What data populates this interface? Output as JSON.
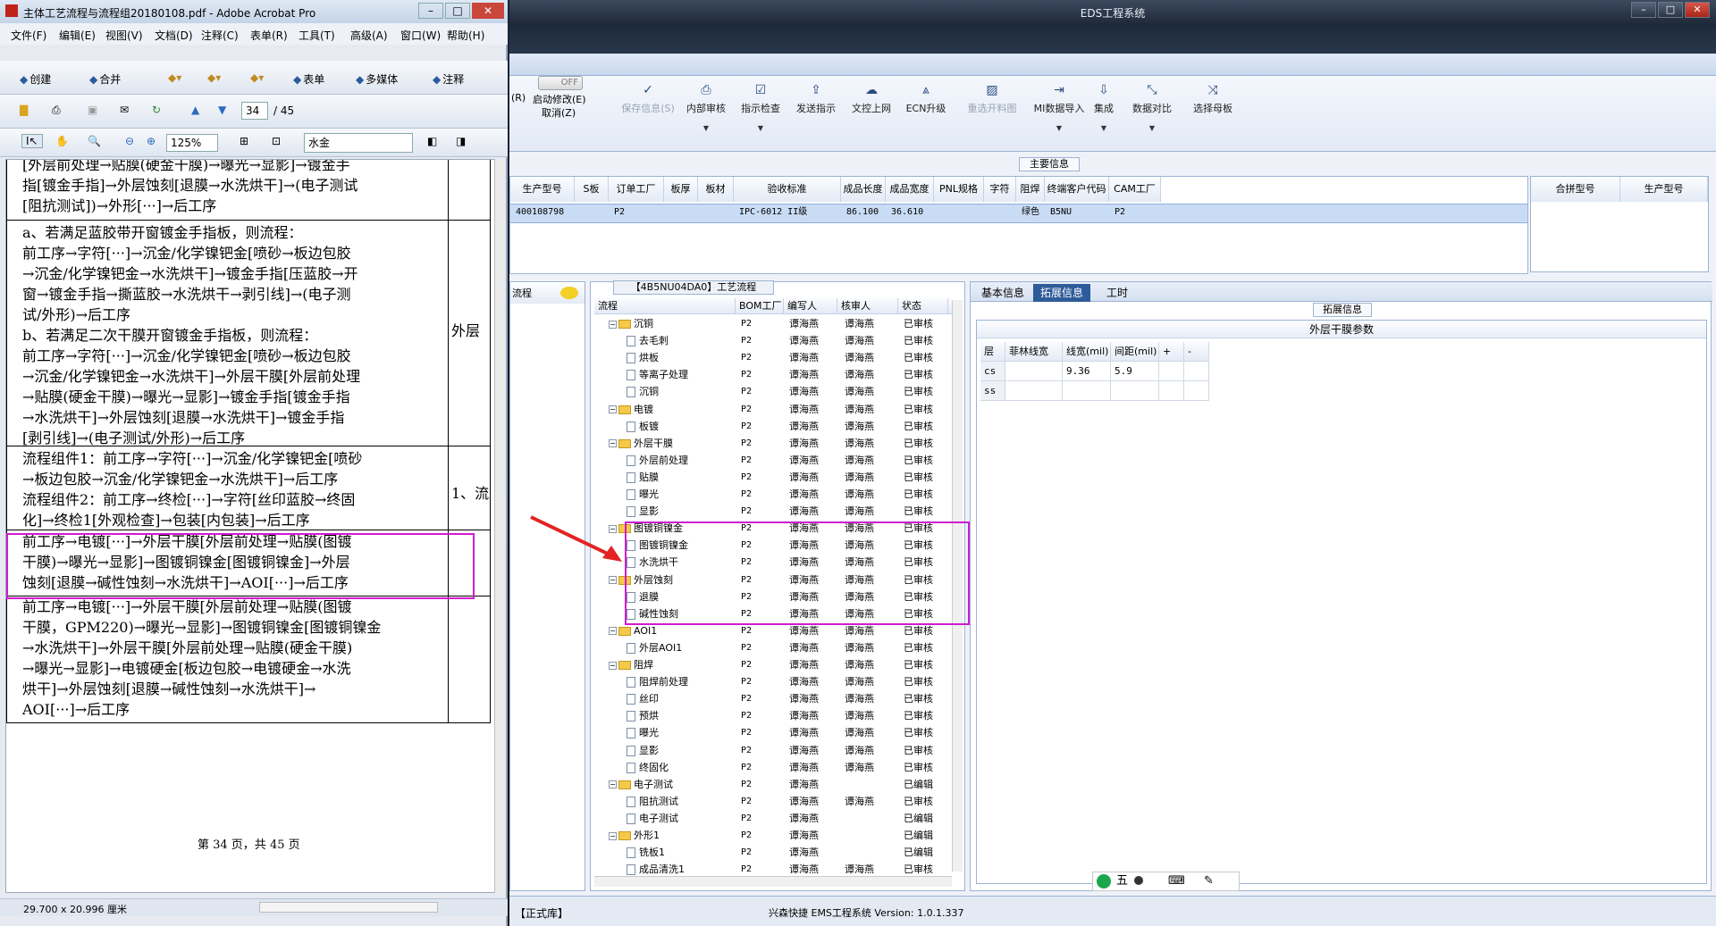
{
  "acrobat": {
    "title": "主体工艺流程与流程组20180108.pdf - Adobe Acrobat Pro",
    "menu": [
      "文件(F)",
      "编辑(E)",
      "视图(V)",
      "文档(D)",
      "注释(C)",
      "表单(R)",
      "工具(T)",
      "高级(A)",
      "窗口(W)",
      "帮助(H)"
    ],
    "toolbar1": [
      "创建",
      "合并",
      "表单",
      "多媒体",
      "注释"
    ],
    "page_current": "34",
    "page_total": "/ 45",
    "zoom": "125%",
    "search_value": "水金",
    "page_size": "29.700 x 20.996 厘米",
    "footer": "第 34 页，共 45 页",
    "lines": [
      "[外层前处理→贴膜(硬金干膜)→曝光→显影]→镀金手",
      "指[镀金手指]→外层蚀刻[退膜→水洗烘干]→(电子测试",
      "[阻抗测试])→外形[···]→后工序",
      "a、若满足蓝胶带开窗镀金手指板，则流程：",
      "前工序→字符[···]→沉金/化学镍钯金[喷砂→板边包胶",
      "→沉金/化学镍钯金→水洗烘干]→镀金手指[压蓝胶→开",
      "窗→镀金手指→撕蓝胶→水洗烘干→剥引线]→(电子测",
      "试/外形)→后工序",
      "b、若满足二次干膜开窗镀金手指板，则流程：",
      "前工序→字符[···]→沉金/化学镍钯金[喷砂→板边包胶",
      "→沉金/化学镍钯金→水洗烘干]→外层干膜[外层前处理",
      "→贴膜(硬金干膜)→曝光→显影]→镀金手指[镀金手指",
      "→水洗烘干]→外层蚀刻[退膜→水洗烘干]→镀金手指",
      "[剥引线]→(电子测试/外形)→后工序",
      "流程组件1：前工序→字符[···]→沉金/化学镍钯金[喷砂",
      "→板边包胶→沉金/化学镍钯金→水洗烘干]→后工序",
      "流程组件2：前工序→终检[···]→字符[丝印蓝胶→终固",
      "化]→终检1[外观检查]→包装[内包装]→后工序",
      "前工序→电镀[···]→外层干膜[外层前处理→贴膜(图镀",
      "干膜)→曝光→显影]→图镀铜镍金[图镀铜镍金]→外层",
      "蚀刻[退膜→碱性蚀刻→水洗烘干]→AOI[···]→后工序",
      "前工序→电镀[···]→外层干膜[外层前处理→贴膜(图镀",
      "干膜，GPM220)→曝光→显影]→图镀铜镍金[图镀铜镍金",
      "→水洗烘干]→外层干膜[外层前处理→贴膜(硬金干膜)",
      "→曝光→显影]→电镀硬金[板边包胶→电镀硬金→水洗",
      "烘干]→外层蚀刻[退膜→碱性蚀刻→水洗烘干]→",
      "AOI[···]→后工序"
    ],
    "side_col": [
      "外层",
      "1、流"
    ]
  },
  "eds": {
    "title": "EDS工程系统",
    "ribbon_left": [
      "(R)",
      "启动修改(E)",
      "取消(Z)"
    ],
    "toggle": "OFF",
    "ribbon": [
      {
        "label": "保存信息(S)",
        "icon": "save-icon",
        "enabled": false
      },
      {
        "label": "内部审核",
        "icon": "print-icon",
        "enabled": true
      },
      {
        "label": "指示检查",
        "icon": "check-icon",
        "enabled": true
      },
      {
        "label": "发送指示",
        "icon": "send-icon",
        "enabled": true
      },
      {
        "label": "文控上网",
        "icon": "cloud-icon",
        "enabled": true
      },
      {
        "label": "ECN升级",
        "icon": "upgrade-icon",
        "enabled": true
      },
      {
        "label": "重选开料图",
        "icon": "image-icon",
        "enabled": false
      },
      {
        "label": "MI数据导入",
        "icon": "import-icon",
        "enabled": true
      },
      {
        "label": "集成",
        "icon": "download-icon",
        "enabled": true
      },
      {
        "label": "数据对比",
        "icon": "compare-icon",
        "enabled": true
      },
      {
        "label": "选择母板",
        "icon": "shuffle-icon",
        "enabled": true
      }
    ],
    "main_info_label": "主要信息",
    "grid_headers": [
      "生产型号",
      "S板",
      "订单工厂",
      "板厚",
      "板材",
      "验收标准",
      "成品长度",
      "成品宽度",
      "PNL规格",
      "字符",
      "阻焊",
      "终端客户代码",
      "CAM工厂"
    ],
    "grid_row": [
      "400108798",
      "",
      "P2",
      "",
      "",
      "IPC-6012 II级",
      "86.100",
      "36.610",
      "",
      "",
      "绿色",
      "B5NU",
      "P2"
    ],
    "side_headers": [
      "合拼型号",
      "生产型号"
    ],
    "flow_tab": "流程",
    "tree_title": "【4B5NU04DA0】工艺流程",
    "tree_headers": [
      "流程",
      "BOM工厂",
      "编写人",
      "核审人",
      "状态"
    ],
    "tree_rows": [
      {
        "name": "沉铜",
        "level": 0,
        "folder": true,
        "bom": "P2",
        "writer": "谭海燕",
        "checker": "谭海燕",
        "status": "已审核"
      },
      {
        "name": "去毛刺",
        "level": 1,
        "folder": false,
        "bom": "P2",
        "writer": "谭海燕",
        "checker": "谭海燕",
        "status": "已审核"
      },
      {
        "name": "烘板",
        "level": 1,
        "folder": false,
        "bom": "P2",
        "writer": "谭海燕",
        "checker": "谭海燕",
        "status": "已审核"
      },
      {
        "name": "等离子处理",
        "level": 1,
        "folder": false,
        "bom": "P2",
        "writer": "谭海燕",
        "checker": "谭海燕",
        "status": "已审核"
      },
      {
        "name": "沉铜",
        "level": 1,
        "folder": false,
        "bom": "P2",
        "writer": "谭海燕",
        "checker": "谭海燕",
        "status": "已审核"
      },
      {
        "name": "电镀",
        "level": 0,
        "folder": true,
        "bom": "P2",
        "writer": "谭海燕",
        "checker": "谭海燕",
        "status": "已审核"
      },
      {
        "name": "板镀",
        "level": 1,
        "folder": false,
        "bom": "P2",
        "writer": "谭海燕",
        "checker": "谭海燕",
        "status": "已审核"
      },
      {
        "name": "外层干膜",
        "level": 0,
        "folder": true,
        "bom": "P2",
        "writer": "谭海燕",
        "checker": "谭海燕",
        "status": "已审核"
      },
      {
        "name": "外层前处理",
        "level": 1,
        "folder": false,
        "bom": "P2",
        "writer": "谭海燕",
        "checker": "谭海燕",
        "status": "已审核"
      },
      {
        "name": "贴膜",
        "level": 1,
        "folder": false,
        "bom": "P2",
        "writer": "谭海燕",
        "checker": "谭海燕",
        "status": "已审核"
      },
      {
        "name": "曝光",
        "level": 1,
        "folder": false,
        "bom": "P2",
        "writer": "谭海燕",
        "checker": "谭海燕",
        "status": "已审核"
      },
      {
        "name": "显影",
        "level": 1,
        "folder": false,
        "bom": "P2",
        "writer": "谭海燕",
        "checker": "谭海燕",
        "status": "已审核"
      },
      {
        "name": "图镀铜镍金",
        "level": 0,
        "folder": true,
        "bom": "P2",
        "writer": "谭海燕",
        "checker": "谭海燕",
        "status": "已审核"
      },
      {
        "name": "图镀铜镍金",
        "level": 1,
        "folder": false,
        "bom": "P2",
        "writer": "谭海燕",
        "checker": "谭海燕",
        "status": "已审核"
      },
      {
        "name": "水洗烘干",
        "level": 1,
        "folder": false,
        "bom": "P2",
        "writer": "谭海燕",
        "checker": "谭海燕",
        "status": "已审核"
      },
      {
        "name": "外层蚀刻",
        "level": 0,
        "folder": true,
        "bom": "P2",
        "writer": "谭海燕",
        "checker": "谭海燕",
        "status": "已审核"
      },
      {
        "name": "退膜",
        "level": 1,
        "folder": false,
        "bom": "P2",
        "writer": "谭海燕",
        "checker": "谭海燕",
        "status": "已审核"
      },
      {
        "name": "碱性蚀刻",
        "level": 1,
        "folder": false,
        "bom": "P2",
        "writer": "谭海燕",
        "checker": "谭海燕",
        "status": "已审核"
      },
      {
        "name": "AOI1",
        "level": 0,
        "folder": true,
        "bom": "P2",
        "writer": "谭海燕",
        "checker": "谭海燕",
        "status": "已审核"
      },
      {
        "name": "外层AOI1",
        "level": 1,
        "folder": false,
        "bom": "P2",
        "writer": "谭海燕",
        "checker": "谭海燕",
        "status": "已审核"
      },
      {
        "name": "阻焊",
        "level": 0,
        "folder": true,
        "bom": "P2",
        "writer": "谭海燕",
        "checker": "谭海燕",
        "status": "已审核"
      },
      {
        "name": "阻焊前处理",
        "level": 1,
        "folder": false,
        "bom": "P2",
        "writer": "谭海燕",
        "checker": "谭海燕",
        "status": "已审核"
      },
      {
        "name": "丝印",
        "level": 1,
        "folder": false,
        "bom": "P2",
        "writer": "谭海燕",
        "checker": "谭海燕",
        "status": "已审核"
      },
      {
        "name": "预烘",
        "level": 1,
        "folder": false,
        "bom": "P2",
        "writer": "谭海燕",
        "checker": "谭海燕",
        "status": "已审核"
      },
      {
        "name": "曝光",
        "level": 1,
        "folder": false,
        "bom": "P2",
        "writer": "谭海燕",
        "checker": "谭海燕",
        "status": "已审核"
      },
      {
        "name": "显影",
        "level": 1,
        "folder": false,
        "bom": "P2",
        "writer": "谭海燕",
        "checker": "谭海燕",
        "status": "已审核"
      },
      {
        "name": "终固化",
        "level": 1,
        "folder": false,
        "bom": "P2",
        "writer": "谭海燕",
        "checker": "谭海燕",
        "status": "已审核"
      },
      {
        "name": "电子测试",
        "level": 0,
        "folder": true,
        "bom": "P2",
        "writer": "谭海燕",
        "checker": "",
        "status": "已编辑"
      },
      {
        "name": "阻抗测试",
        "level": 1,
        "folder": false,
        "bom": "P2",
        "writer": "谭海燕",
        "checker": "谭海燕",
        "status": "已审核"
      },
      {
        "name": "电子测试",
        "level": 1,
        "folder": false,
        "bom": "P2",
        "writer": "谭海燕",
        "checker": "",
        "status": "已编辑"
      },
      {
        "name": "外形1",
        "level": 0,
        "folder": true,
        "bom": "P2",
        "writer": "谭海燕",
        "checker": "",
        "status": "已编辑"
      },
      {
        "name": "铣板1",
        "level": 1,
        "folder": false,
        "bom": "P2",
        "writer": "谭海燕",
        "checker": "",
        "status": "已编辑"
      },
      {
        "name": "成品清洗1",
        "level": 1,
        "folder": false,
        "bom": "P2",
        "writer": "谭海燕",
        "checker": "谭海燕",
        "status": "已审核"
      }
    ],
    "right_tabs": [
      "基本信息",
      "拓展信息",
      "工时"
    ],
    "ext_label": "拓展信息",
    "param_title": "外层干膜参数",
    "param_headers": [
      "层",
      "菲林线宽",
      "线宽(mil)",
      "间距(mil)",
      "+",
      "-"
    ],
    "param_rows": [
      [
        "cs",
        "",
        "9.36",
        "5.9"
      ],
      [
        "ss",
        "",
        "",
        ""
      ]
    ],
    "status_left": "【正式库】",
    "status_center": "兴森快捷 EMS工程系统 Version: 1.0.1.337",
    "ime": "五"
  },
  "colors": {
    "highlight": "#d01bd0",
    "arrow": "#e32222",
    "selected_row": "#c9dcf5"
  }
}
